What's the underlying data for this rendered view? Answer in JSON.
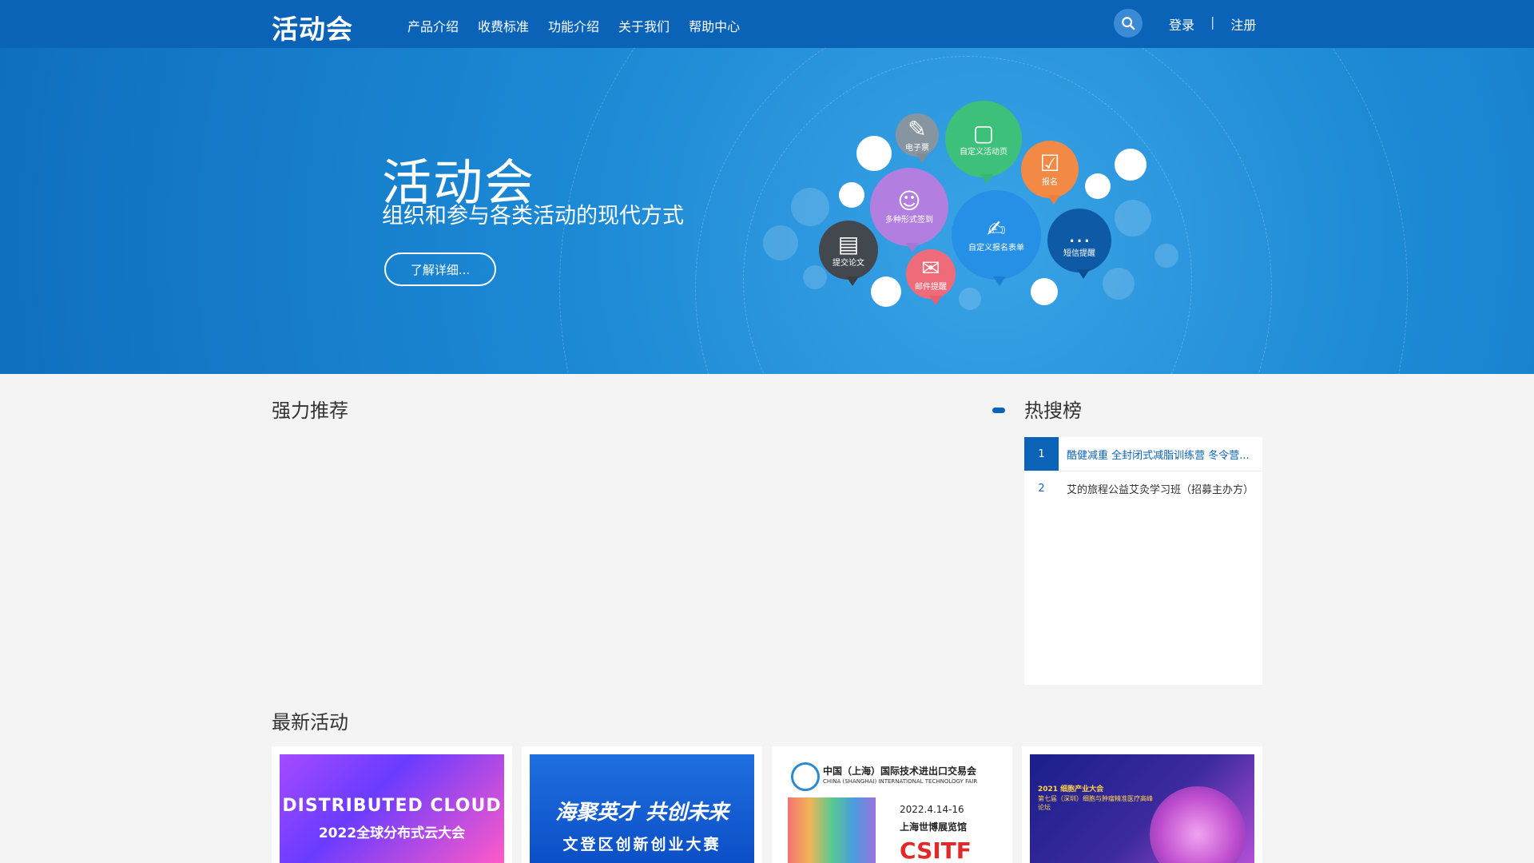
{
  "header": {
    "logo": "活动会",
    "nav": [
      "产品介绍",
      "收费标准",
      "功能介绍",
      "关于我们",
      "帮助中心"
    ],
    "login": "登录",
    "divider": "|",
    "register": "注册"
  },
  "banner": {
    "title": "活动会",
    "subtitle": "组织和参与各类活动的现代方式",
    "button": "了解详细...",
    "bubbles": {
      "ebook": "电子票",
      "custom_page": "自定义活动页",
      "signup": "报名",
      "multi_checkin": "多种形式签到",
      "custom_form": "自定义报名表单",
      "sms_reminder": "短信提醒",
      "submit_paper": "提交论文",
      "email_reminder": "邮件提醒"
    }
  },
  "recommend": {
    "title": "强力推荐"
  },
  "hot": {
    "title": "热搜榜",
    "items": [
      {
        "rank": "1",
        "text": "酷健减重 全封闭式减脂训练营 冬令营..."
      },
      {
        "rank": "2",
        "text": "艾的旅程公益艾灸学习班（招募主办方）"
      }
    ]
  },
  "latest": {
    "title": "最新活动",
    "cards": [
      {
        "line1": "DISTRIBUTED CLOUD",
        "line2": "2022全球分布式云大会"
      },
      {
        "line1": "海聚英才 共创未来",
        "line2": "文登区创新创业大赛"
      },
      {
        "line1": "中国（上海）国际技术进出口交易会",
        "line2": "CHINA (SHANGHAI) INTERNATIONAL TECHNOLOGY FAIR",
        "date": "2022.4.14-16",
        "venue": "上海世博展览馆",
        "brand": "CSITF"
      },
      {
        "line1": "2021 细胞产业大会",
        "line2": "第七届（深圳）细胞与肿瘤精准医疗高峰论坛"
      }
    ]
  }
}
